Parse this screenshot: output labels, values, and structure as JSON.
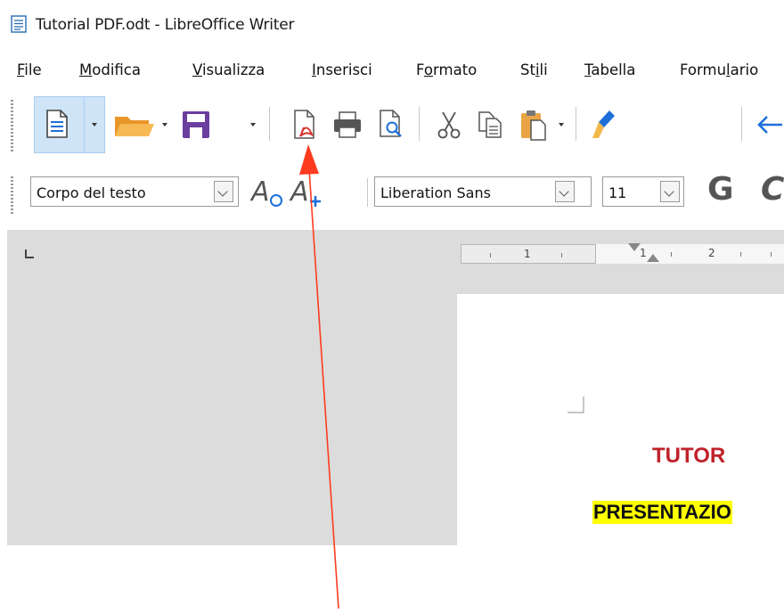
{
  "window": {
    "title": "Tutorial  PDF.odt - LibreOffice Writer"
  },
  "menu": {
    "items": [
      {
        "pre": "",
        "u": "F",
        "post": "ile"
      },
      {
        "pre": "",
        "u": "M",
        "post": "odifica"
      },
      {
        "pre": "",
        "u": "V",
        "post": "isualizza"
      },
      {
        "pre": "",
        "u": "I",
        "post": "nserisci"
      },
      {
        "pre": "F",
        "u": "o",
        "post": "rmato"
      },
      {
        "pre": "St",
        "u": "i",
        "post": "li"
      },
      {
        "pre": "",
        "u": "T",
        "post": "abella"
      },
      {
        "pre": "Formu",
        "u": "l",
        "post": "ario"
      }
    ]
  },
  "toolbar": {
    "icons": [
      "new-document-icon",
      "open-folder-icon",
      "save-icon",
      "export-pdf-icon",
      "print-icon",
      "print-preview-icon",
      "cut-icon",
      "copy-icon",
      "paste-icon",
      "clone-formatting-icon",
      "undo-icon"
    ]
  },
  "formatting": {
    "paragraph_style": "Corpo del testo",
    "font_name": "Liberation Sans",
    "font_size": "11",
    "bold_label": "G",
    "italic_label_partial": "C"
  },
  "ruler": {
    "numbers": [
      "1",
      "1",
      "2"
    ]
  },
  "document": {
    "title": "TUTOR",
    "subtitle": "PRESENTAZIO"
  },
  "colors": {
    "accent_blue": "#1e6fd9",
    "pdf_red": "#d9302c",
    "save_purple": "#6a3fa0",
    "folder_orange": "#f2a43a",
    "title_red": "#c0222a",
    "highlight_yellow": "#ffff00",
    "arrow_red": "#ff3b1f"
  }
}
